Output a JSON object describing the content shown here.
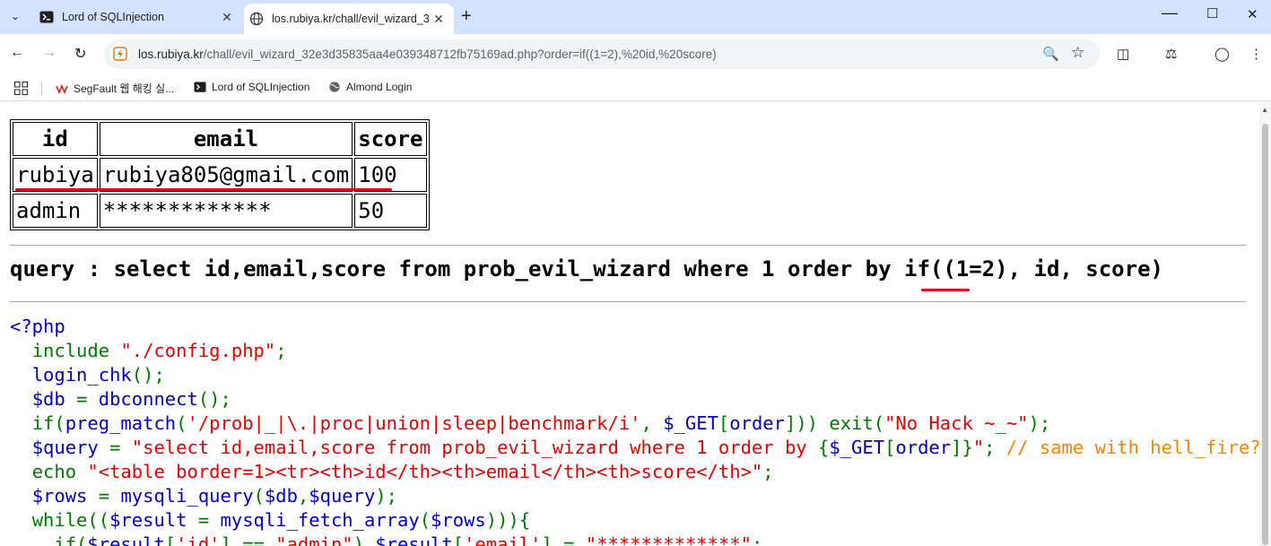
{
  "browser": {
    "tabs": [
      {
        "title": "Lord of SQLInjection",
        "active": false
      },
      {
        "title": "los.rubiya.kr/chall/evil_wizard_3",
        "active": true
      }
    ],
    "url_domain": "los.rubiya.kr",
    "url_path": "/chall/evil_wizard_32e3d35835aa4e039348712fb75169ad.php?order=if((1=2),%20id,%20score)",
    "bookmarks": [
      {
        "label": "SegFault 웹 해킹 실..."
      },
      {
        "label": "Lord of SQLInjection"
      },
      {
        "label": "Almond Login"
      }
    ],
    "colors": {
      "tabstrip": "#d3e3fd",
      "omnibox": "#f1f3f4",
      "annotation_red": "#e0001b"
    }
  },
  "result_table": {
    "headers": [
      "id",
      "email",
      "score"
    ],
    "rows": [
      [
        "rubiya",
        "rubiya805@gmail.com",
        "100"
      ],
      [
        "admin",
        "*************",
        "50"
      ]
    ]
  },
  "query_text": "query : select id,email,score from prob_evil_wizard where 1 order by if((1=2), id, score)",
  "code_lines": [
    [
      {
        "t": "<?php",
        "c": "k"
      }
    ],
    [
      {
        "t": "  ",
        "c": "g"
      },
      {
        "t": "include ",
        "c": "g"
      },
      {
        "t": "\"./config.php\"",
        "c": "s"
      },
      {
        "t": ";",
        "c": "g"
      }
    ],
    [
      {
        "t": "  ",
        "c": "g"
      },
      {
        "t": "login_chk",
        "c": "k"
      },
      {
        "t": "();",
        "c": "g"
      }
    ],
    [
      {
        "t": "  ",
        "c": "g"
      },
      {
        "t": "$db ",
        "c": "k"
      },
      {
        "t": "= ",
        "c": "g"
      },
      {
        "t": "dbconnect",
        "c": "k"
      },
      {
        "t": "();",
        "c": "g"
      }
    ],
    [
      {
        "t": "  ",
        "c": "g"
      },
      {
        "t": "if(",
        "c": "g"
      },
      {
        "t": "preg_match",
        "c": "k"
      },
      {
        "t": "(",
        "c": "g"
      },
      {
        "t": "'/prob|_|\\.|proc|union|sleep|benchmark/i'",
        "c": "s"
      },
      {
        "t": ", ",
        "c": "g"
      },
      {
        "t": "$_GET",
        "c": "k"
      },
      {
        "t": "[",
        "c": "g"
      },
      {
        "t": "order",
        "c": "k"
      },
      {
        "t": "])) exit(",
        "c": "g"
      },
      {
        "t": "\"No Hack ~_~\"",
        "c": "s"
      },
      {
        "t": ");",
        "c": "g"
      }
    ],
    [
      {
        "t": "  ",
        "c": "g"
      },
      {
        "t": "$query ",
        "c": "k"
      },
      {
        "t": "= ",
        "c": "g"
      },
      {
        "t": "\"select id,email,score from prob_evil_wizard where 1 order by ",
        "c": "s"
      },
      {
        "t": "{",
        "c": "g"
      },
      {
        "t": "$_GET",
        "c": "k"
      },
      {
        "t": "[",
        "c": "g"
      },
      {
        "t": "order",
        "c": "k"
      },
      {
        "t": "]}",
        "c": "g"
      },
      {
        "t": "\"",
        "c": "s"
      },
      {
        "t": "; ",
        "c": "g"
      },
      {
        "t": "// same with hell_fire? really?",
        "c": "c"
      }
    ],
    [
      {
        "t": "  ",
        "c": "g"
      },
      {
        "t": "echo ",
        "c": "g"
      },
      {
        "t": "\"<table border=1><tr><th>id</th><th>email</th><th>score</th>\"",
        "c": "s"
      },
      {
        "t": ";",
        "c": "g"
      }
    ],
    [
      {
        "t": "  ",
        "c": "g"
      },
      {
        "t": "$rows ",
        "c": "k"
      },
      {
        "t": "= ",
        "c": "g"
      },
      {
        "t": "mysqli_query",
        "c": "k"
      },
      {
        "t": "(",
        "c": "g"
      },
      {
        "t": "$db",
        "c": "k"
      },
      {
        "t": ",",
        "c": "g"
      },
      {
        "t": "$query",
        "c": "k"
      },
      {
        "t": ");",
        "c": "g"
      }
    ],
    [
      {
        "t": "  ",
        "c": "g"
      },
      {
        "t": "while((",
        "c": "g"
      },
      {
        "t": "$result ",
        "c": "k"
      },
      {
        "t": "= ",
        "c": "g"
      },
      {
        "t": "mysqli_fetch_array",
        "c": "k"
      },
      {
        "t": "(",
        "c": "g"
      },
      {
        "t": "$rows",
        "c": "k"
      },
      {
        "t": "))){",
        "c": "g"
      }
    ],
    [
      {
        "t": "    ",
        "c": "g"
      },
      {
        "t": "if(",
        "c": "g"
      },
      {
        "t": "$result",
        "c": "k"
      },
      {
        "t": "[",
        "c": "g"
      },
      {
        "t": "'id'",
        "c": "s"
      },
      {
        "t": "] == ",
        "c": "g"
      },
      {
        "t": "\"admin\"",
        "c": "s"
      },
      {
        "t": ") ",
        "c": "g"
      },
      {
        "t": "$result",
        "c": "k"
      },
      {
        "t": "[",
        "c": "g"
      },
      {
        "t": "'email'",
        "c": "s"
      },
      {
        "t": "] = ",
        "c": "g"
      },
      {
        "t": "\"*************\"",
        "c": "s"
      },
      {
        "t": ";",
        "c": "g"
      }
    ]
  ]
}
